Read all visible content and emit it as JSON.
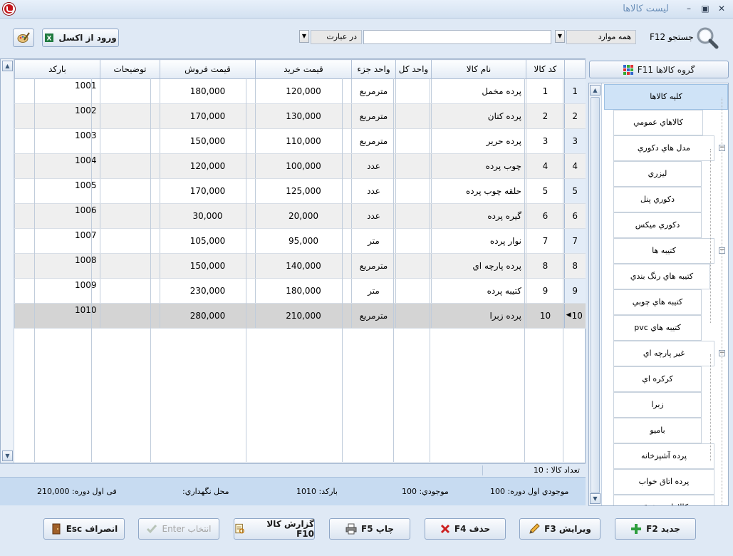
{
  "window": {
    "title": "لیست کالاها",
    "minimize": "–",
    "maximize": "▣",
    "close": "✕"
  },
  "toolbar": {
    "excel_button": "ورود از اکسل",
    "search_label": "جستجو F12",
    "scope_combo": "همه موارد",
    "match_combo": "در عبارت",
    "search_value": ""
  },
  "grid": {
    "columns": [
      "کد کالا",
      "نام کالا",
      "واحد کل",
      "واحد جزء",
      "قیمت خرید",
      "قیمت فروش",
      "توضیحات",
      "بارکد"
    ],
    "rows": [
      {
        "idx": "1",
        "code": "1",
        "name": "پرده مخمل",
        "unit_total": "",
        "unit_part": "مترمربع",
        "buy": "120,000",
        "sell": "180,000",
        "desc": "",
        "barcode": "1001"
      },
      {
        "idx": "2",
        "code": "2",
        "name": "پرده کتان",
        "unit_total": "",
        "unit_part": "مترمربع",
        "buy": "130,000",
        "sell": "170,000",
        "desc": "",
        "barcode": "1002"
      },
      {
        "idx": "3",
        "code": "3",
        "name": "پرده حرير",
        "unit_total": "",
        "unit_part": "مترمربع",
        "buy": "110,000",
        "sell": "150,000",
        "desc": "",
        "barcode": "1003"
      },
      {
        "idx": "4",
        "code": "4",
        "name": "چوب پرده",
        "unit_total": "",
        "unit_part": "عدد",
        "buy": "100,000",
        "sell": "120,000",
        "desc": "",
        "barcode": "1004"
      },
      {
        "idx": "5",
        "code": "5",
        "name": "حلقه چوب پرده",
        "unit_total": "",
        "unit_part": "عدد",
        "buy": "125,000",
        "sell": "170,000",
        "desc": "",
        "barcode": "1005"
      },
      {
        "idx": "6",
        "code": "6",
        "name": "گيره پرده",
        "unit_total": "",
        "unit_part": "عدد",
        "buy": "20,000",
        "sell": "30,000",
        "desc": "",
        "barcode": "1006"
      },
      {
        "idx": "7",
        "code": "7",
        "name": "نوار پرده",
        "unit_total": "",
        "unit_part": "متر",
        "buy": "95,000",
        "sell": "105,000",
        "desc": "",
        "barcode": "1007"
      },
      {
        "idx": "8",
        "code": "8",
        "name": "پرده پارچه اي",
        "unit_total": "",
        "unit_part": "مترمربع",
        "buy": "140,000",
        "sell": "150,000",
        "desc": "",
        "barcode": "1008"
      },
      {
        "idx": "9",
        "code": "9",
        "name": "کتيبه پرده",
        "unit_total": "",
        "unit_part": "متر",
        "buy": "180,000",
        "sell": "230,000",
        "desc": "",
        "barcode": "1009"
      },
      {
        "idx": "10",
        "code": "10",
        "name": "پرده زبرا",
        "unit_total": "",
        "unit_part": "مترمربع",
        "buy": "210,000",
        "sell": "280,000",
        "desc": "",
        "barcode": "1010"
      }
    ],
    "count_text": "تعداد کالا : 10"
  },
  "info": {
    "opening_stock": "موجودي اول دوره: 100",
    "stock": "موجودي: 100",
    "barcode": "بارکد: 1010",
    "location": "محل نگهداري:",
    "opening_price": "فی اول دوره: 210,000"
  },
  "groups_button": "گروه کالاها F11",
  "tree": {
    "nodes": [
      "کليه کالاها",
      "کالاهاي عمومي",
      "مدل هاي دکوري",
      "ليزري",
      "دکوري پنل",
      "دکوري ميکس",
      "کتيبه ها",
      "کتيبه هاي رنگ بندي",
      "کتيبه هاي چوبي",
      "کتيبه هاي pvc",
      "غير پارچه اي",
      "کرکره اي",
      "زبرا",
      "باميو",
      "پرده آشپزخانه",
      "پرده اتاق خواب",
      "کالاهاي متفرقه"
    ]
  },
  "buttons": {
    "new": "جديد F2",
    "edit": "ويرايش F3",
    "delete": "حذف F4",
    "print": "چاپ F5",
    "report": "گزارش کالا F10",
    "select": "انتخاب Enter",
    "cancel": "انصراف Esc"
  },
  "colors": {
    "accent": "#c4161c",
    "selection": "#cfe3f7",
    "header_bg": "#dfe9f5",
    "info_bg": "#c7dbf1"
  }
}
